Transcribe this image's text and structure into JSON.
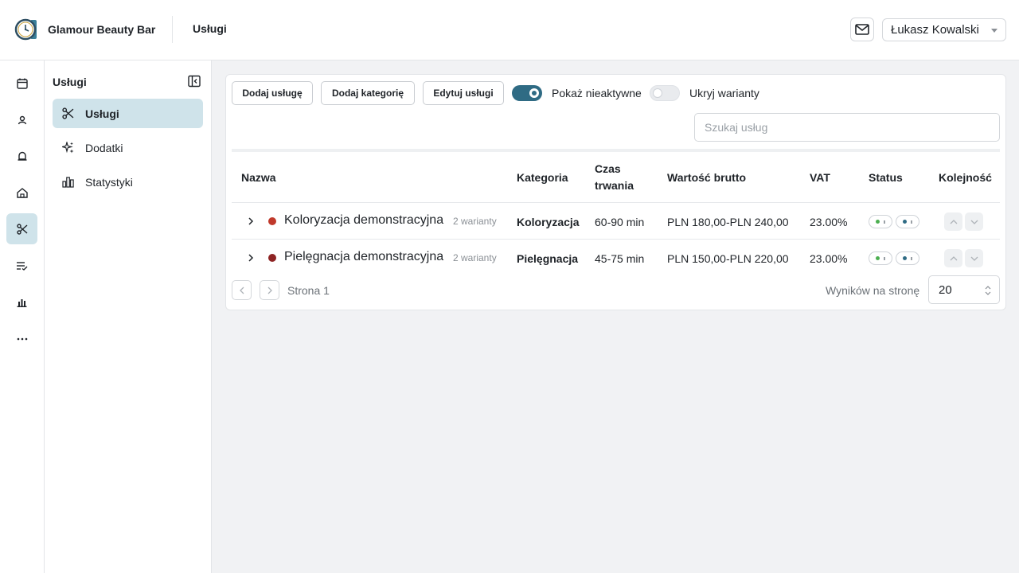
{
  "header": {
    "brand": "Glamour Beauty Bar",
    "page_title": "Usługi",
    "user_name": "Łukasz Kowalski",
    "icons": [
      "clock-logo-icon",
      "mail-icon",
      "chevron-down-icon"
    ]
  },
  "rail": {
    "items": [
      {
        "name": "calendar-icon",
        "active": false
      },
      {
        "name": "clients-icon",
        "active": false
      },
      {
        "name": "bell-icon",
        "active": false
      },
      {
        "name": "home-icon",
        "active": false
      },
      {
        "name": "scissors-icon",
        "active": true
      },
      {
        "name": "checklist-icon",
        "active": false
      },
      {
        "name": "bar-chart-icon",
        "active": false
      },
      {
        "name": "more-icon",
        "active": false
      }
    ]
  },
  "subnav": {
    "title": "Usługi",
    "items": [
      {
        "label": "Usługi",
        "icon": "scissors-icon",
        "active": true
      },
      {
        "label": "Dodatki",
        "icon": "sparkles-icon",
        "active": false
      },
      {
        "label": "Statystyki",
        "icon": "stats-icon",
        "active": false
      }
    ]
  },
  "toolbar": {
    "add_service": "Dodaj usługę",
    "add_category": "Dodaj kategorię",
    "edit_services": "Edytuj usługi",
    "show_inactive_label": "Pokaż nieaktywne",
    "show_inactive_on": true,
    "hide_variants_label": "Ukryj warianty",
    "hide_variants_on": false,
    "search_placeholder": "Szukaj usług"
  },
  "table": {
    "columns": {
      "name": "Nazwa",
      "category": "Kategoria",
      "duration_line1": "Czas",
      "duration_line2": "trwania",
      "price": "Wartość brutto",
      "vat": "VAT",
      "status": "Status",
      "order": "Kolejność"
    },
    "rows": [
      {
        "name": "Koloryzacja demonstracyjna",
        "variants": "2 warianty",
        "dot_color": "#c0392b",
        "category": "Koloryzacja",
        "duration": "60-90 min",
        "price": "PLN 180,00-PLN 240,00",
        "vat": "23.00%"
      },
      {
        "name": "Pielęgnacja demonstracyjna",
        "variants": "2 warianty",
        "dot_color": "#8e2424",
        "category": "Pielęgnacja",
        "duration": "45-75 min",
        "price": "PLN 150,00-PLN 220,00",
        "vat": "23.00%"
      }
    ]
  },
  "pagination": {
    "page_text": "Strona 1",
    "per_page_label": "Wyników na stronę",
    "per_page_value": "20"
  },
  "colors": {
    "accent": "#2f6b84",
    "active_bg": "#cfe3ea",
    "status_green": "#4caf50",
    "status_teal": "#2f6b84"
  }
}
